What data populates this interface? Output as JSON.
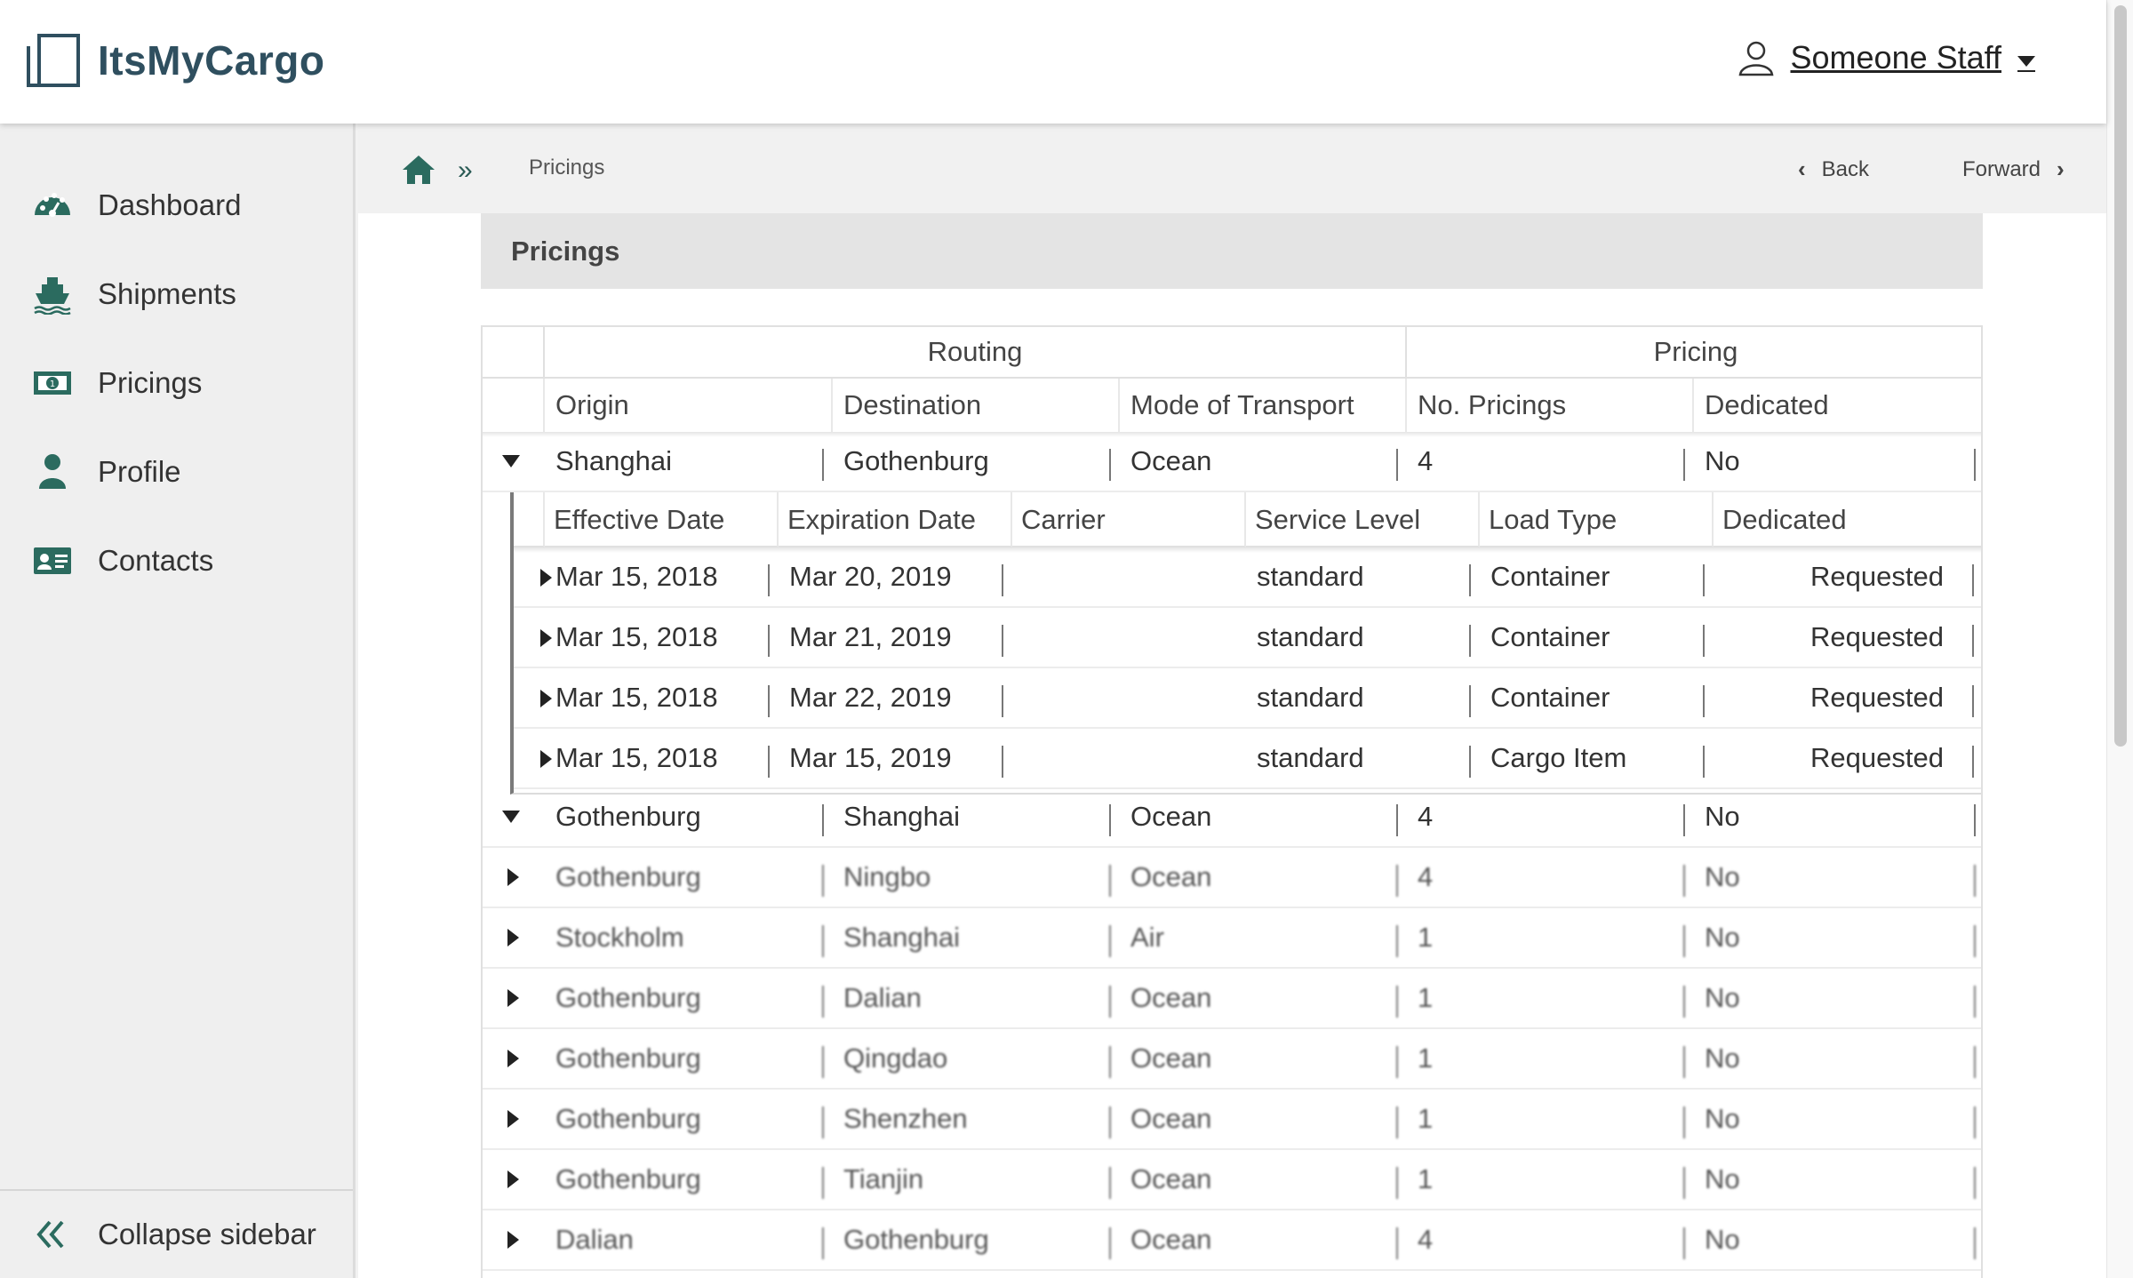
{
  "app": {
    "name": "ItsMyCargo"
  },
  "user": {
    "name": "Someone Staff"
  },
  "sidebar": {
    "items": [
      {
        "label": "Dashboard",
        "icon": "dashboard-gauge-icon"
      },
      {
        "label": "Shipments",
        "icon": "ship-icon"
      },
      {
        "label": "Pricings",
        "icon": "money-bill-icon"
      },
      {
        "label": "Profile",
        "icon": "user-icon"
      },
      {
        "label": "Contacts",
        "icon": "id-card-icon"
      }
    ],
    "collapse_label": "Collapse sidebar"
  },
  "breadcrumb": {
    "current": "Pricings",
    "back_label": "Back",
    "forward_label": "Forward"
  },
  "page": {
    "title": "Pricings"
  },
  "table": {
    "group_headers": {
      "routing": "Routing",
      "pricing": "Pricing"
    },
    "columns": {
      "origin": "Origin",
      "destination": "Destination",
      "mode": "Mode of Transport",
      "count": "No. Pricings",
      "dedicated": "Dedicated"
    },
    "sub_columns": {
      "effective": "Effective Date",
      "expiration": "Expiration Date",
      "carrier": "Carrier",
      "service": "Service Level",
      "load": "Load Type",
      "dedicated": "Dedicated"
    },
    "rows": [
      {
        "origin": "Shanghai",
        "destination": "Gothenburg",
        "mode": "Ocean",
        "count": "4",
        "dedicated": "No",
        "expanded": true,
        "pricings": [
          {
            "effective": "Mar 15, 2018",
            "expiration": "Mar 20, 2019",
            "carrier": "",
            "service": "standard",
            "load": "Container",
            "dedicated": "Requested"
          },
          {
            "effective": "Mar 15, 2018",
            "expiration": "Mar 21, 2019",
            "carrier": "",
            "service": "standard",
            "load": "Container",
            "dedicated": "Requested"
          },
          {
            "effective": "Mar 15, 2018",
            "expiration": "Mar 22, 2019",
            "carrier": "",
            "service": "standard",
            "load": "Container",
            "dedicated": "Requested"
          },
          {
            "effective": "Mar 15, 2018",
            "expiration": "Mar 15, 2019",
            "carrier": "",
            "service": "standard",
            "load": "Cargo Item",
            "dedicated": "Requested"
          }
        ]
      },
      {
        "origin": "Gothenburg",
        "destination": "Shanghai",
        "mode": "Ocean",
        "count": "4",
        "dedicated": "No",
        "expanded": true
      },
      {
        "origin": "Gothenburg",
        "destination": "Ningbo",
        "mode": "Ocean",
        "count": "4",
        "dedicated": "No"
      },
      {
        "origin": "Stockholm",
        "destination": "Shanghai",
        "mode": "Air",
        "count": "1",
        "dedicated": "No"
      },
      {
        "origin": "Gothenburg",
        "destination": "Dalian",
        "mode": "Ocean",
        "count": "1",
        "dedicated": "No"
      },
      {
        "origin": "Gothenburg",
        "destination": "Qingdao",
        "mode": "Ocean",
        "count": "1",
        "dedicated": "No"
      },
      {
        "origin": "Gothenburg",
        "destination": "Shenzhen",
        "mode": "Ocean",
        "count": "1",
        "dedicated": "No"
      },
      {
        "origin": "Gothenburg",
        "destination": "Tianjin",
        "mode": "Ocean",
        "count": "1",
        "dedicated": "No"
      },
      {
        "origin": "Dalian",
        "destination": "Gothenburg",
        "mode": "Ocean",
        "count": "4",
        "dedicated": "No"
      }
    ]
  },
  "colors": {
    "brand": "#2f4f5f",
    "accent": "#2b6b5f",
    "sidebar_bg": "#efefef"
  }
}
